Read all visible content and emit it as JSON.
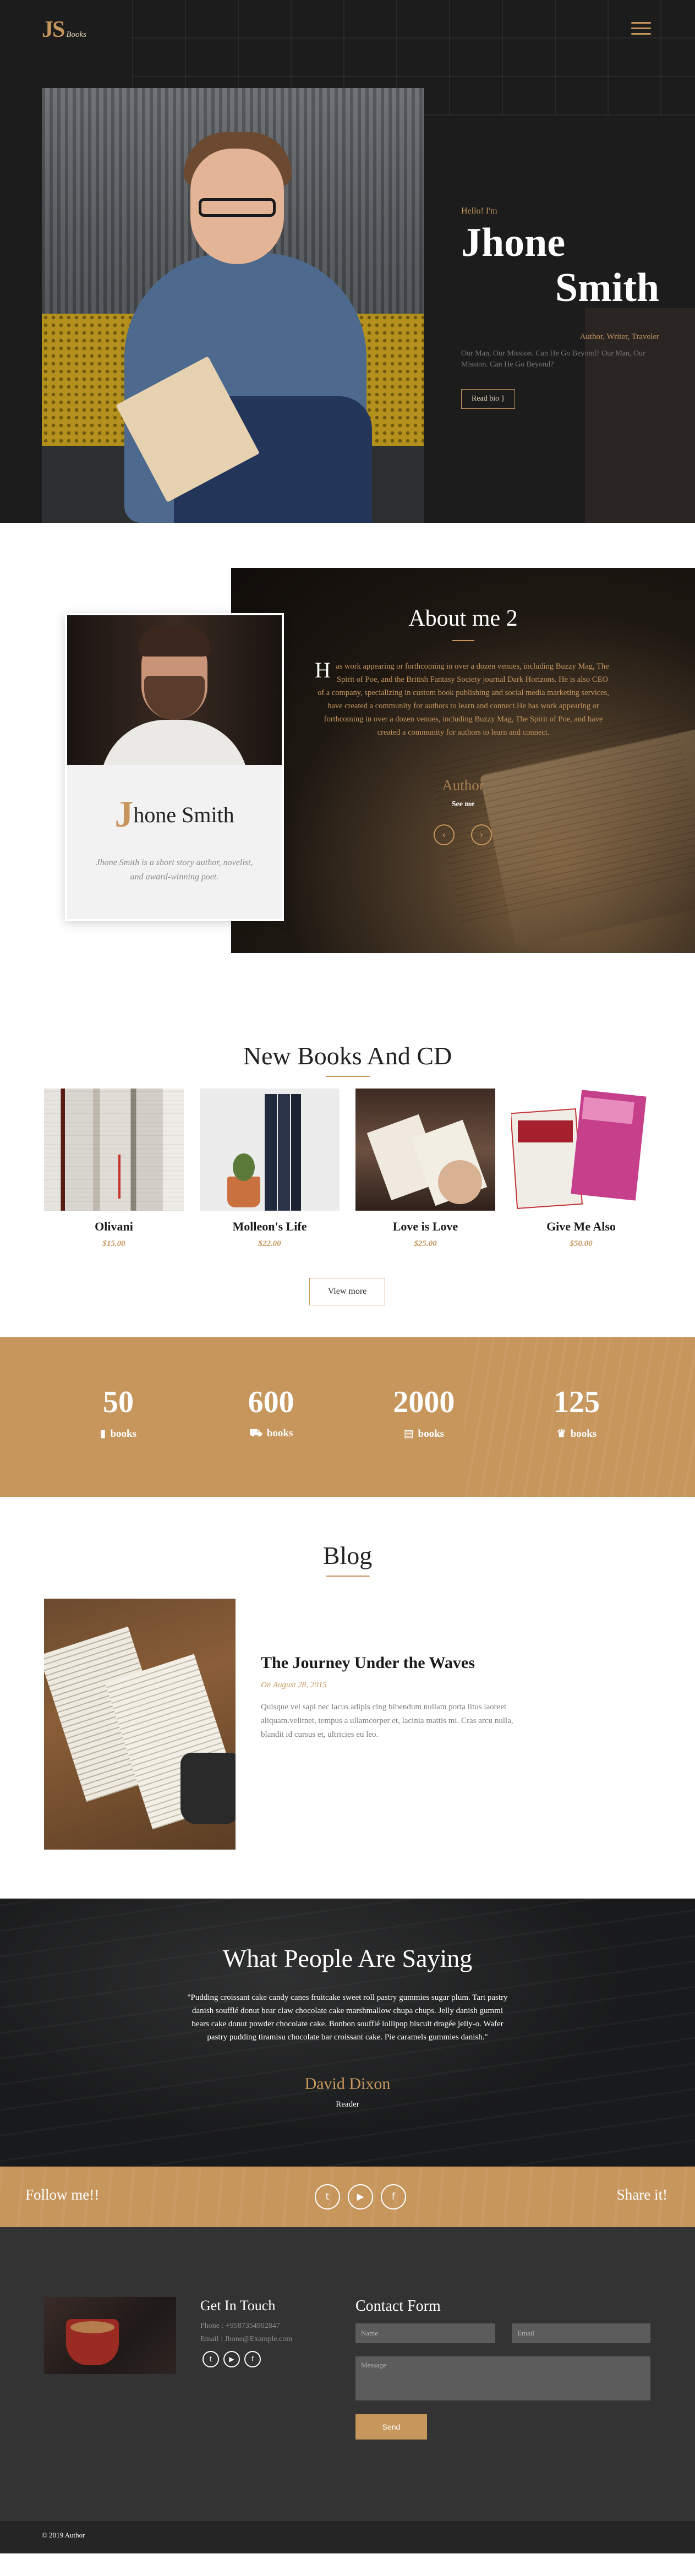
{
  "nav": {
    "logo_mark": "JS",
    "logo_sub": "Books"
  },
  "hero": {
    "hello": "Hello! I'm",
    "first_name": "Jhone",
    "last_name": "Smith",
    "roles": "Author, Writer, Traveler",
    "description": "Our Man, Our Mission. Can He Go Beyond? Our Man, Our Mission. Can He Go Beyond?",
    "read_button": "Read bio }"
  },
  "about": {
    "title": "About me 2",
    "drop_cap": "H",
    "body": "as work appearing or forthcoming in over a dozen venues, including Buzzy Mag, The Spirit of Poe, and the British Fantasy Society journal Dark Horizons. He is also CEO of a company, specializing in custom book publishing and social media marketing services, have created a community for authors to learn and connect.He has work appearing or forthcoming in over a dozen venues, including Buzzy Mag, The Spirit of Poe, and have created a community for authors to learn and connect.",
    "role": "Author",
    "see_more": "See me",
    "prev_icon": "chevron-left-icon",
    "next_icon": "chevron-right-icon",
    "prev_glyph": "‹",
    "next_glyph": "›"
  },
  "profile": {
    "name_cap": "J",
    "name_rest": "hone Smith",
    "description": "Jhone Smith is a short story author, novelist, and award-winning poet."
  },
  "books": {
    "title": "New Books And CD",
    "items": [
      {
        "title": "Olivani",
        "price": "$15.00"
      },
      {
        "title": "Molleon's Life",
        "price": "$22.00"
      },
      {
        "title": "Love is Love",
        "price": "$25.00"
      },
      {
        "title": "Give Me Also",
        "price": "$50.00"
      }
    ],
    "view_more": "View more"
  },
  "stats": [
    {
      "value": "50",
      "label": "books",
      "icon": "book-icon",
      "glyph": "▮"
    },
    {
      "value": "600",
      "label": "books",
      "icon": "cart-icon",
      "glyph": "⛟"
    },
    {
      "value": "2000",
      "label": "books",
      "icon": "map-icon",
      "glyph": "▤"
    },
    {
      "value": "125",
      "label": "books",
      "icon": "trophy-icon",
      "glyph": "♛"
    }
  ],
  "blog": {
    "title": "Blog",
    "post_title": "The Journey Under the Waves",
    "date": "On August 28, 2015",
    "excerpt": "Quisque vel sapi nec lacus adipis cing bibendum nullam porta litus laoreet aliquam.velitnet, tempus a ullamcorper et, lacinia mattis mi. Cras arcu nulla, blandit id cursus et, ultricies eu leo."
  },
  "testimonial": {
    "title": "What People Are Saying",
    "quote": "\"Pudding croissant cake candy canes fruitcake sweet roll pastry gummies sugar plum. Tart pastry danish soufflé donut bear claw chocolate cake marshmallow chupa chups. Jelly danish gummi bears cake donut powder chocolate cake. Bonbon soufflé lollipop biscuit dragée jelly-o. Wafer pastry pudding tiramisu chocolate bar croissant cake. Pie caramels gummies danish.\"",
    "name": "David Dixon",
    "role": "Reader"
  },
  "follow": {
    "follow_text": "Follow me!!",
    "share_text": "Share it!",
    "socials": [
      {
        "icon": "twitter-icon",
        "glyph": "t"
      },
      {
        "icon": "youtube-icon",
        "glyph": "▶"
      },
      {
        "icon": "facebook-icon",
        "glyph": "f"
      }
    ]
  },
  "footer": {
    "get_in_touch": "Get In Touch",
    "phone": "Phone : +9587354902847",
    "email": "Email : Jhone@Example.com",
    "contact_title": "Contact Form",
    "name_placeholder": "Name",
    "email_placeholder": "Email",
    "message_placeholder": "Message",
    "send": "Send",
    "copyright": "© 2019 Author"
  },
  "colors": {
    "accent": "#c7965d",
    "dark": "#1c1c1c",
    "footer": "#333333"
  }
}
